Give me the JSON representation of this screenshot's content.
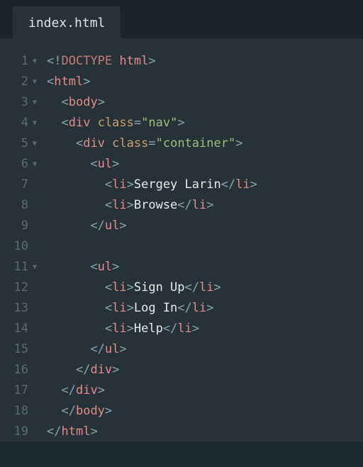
{
  "tab": {
    "filename": "index.html"
  },
  "gutter": {
    "numbers": [
      "1",
      "2",
      "3",
      "4",
      "5",
      "6",
      "7",
      "8",
      "9",
      "10",
      "11",
      "12",
      "13",
      "14",
      "15",
      "16",
      "17",
      "18",
      "19"
    ],
    "folds": [
      true,
      true,
      true,
      true,
      true,
      true,
      false,
      false,
      false,
      false,
      true,
      false,
      false,
      false,
      false,
      false,
      false,
      false,
      false
    ]
  },
  "code": {
    "lines": [
      {
        "indent": 0,
        "kind": "doctype",
        "tag": "html"
      },
      {
        "indent": 0,
        "kind": "open",
        "tag": "html"
      },
      {
        "indent": 1,
        "kind": "open",
        "tag": "body"
      },
      {
        "indent": 1,
        "kind": "open",
        "tag": "div",
        "attr": "class",
        "val": "nav"
      },
      {
        "indent": 2,
        "kind": "open",
        "tag": "div",
        "attr": "class",
        "val": "container"
      },
      {
        "indent": 3,
        "kind": "open",
        "tag": "ul"
      },
      {
        "indent": 4,
        "kind": "li",
        "text": "Sergey Larin"
      },
      {
        "indent": 4,
        "kind": "li",
        "text": "Browse"
      },
      {
        "indent": 3,
        "kind": "close",
        "tag": "ul"
      },
      {
        "indent": 0,
        "kind": "blank"
      },
      {
        "indent": 3,
        "kind": "open",
        "tag": "ul"
      },
      {
        "indent": 4,
        "kind": "li",
        "text": "Sign Up"
      },
      {
        "indent": 4,
        "kind": "li",
        "text": "Log In"
      },
      {
        "indent": 4,
        "kind": "li",
        "text": "Help"
      },
      {
        "indent": 3,
        "kind": "close",
        "tag": "ul"
      },
      {
        "indent": 2,
        "kind": "close",
        "tag": "div"
      },
      {
        "indent": 1,
        "kind": "close",
        "tag": "div"
      },
      {
        "indent": 1,
        "kind": "close",
        "tag": "body"
      },
      {
        "indent": 0,
        "kind": "close",
        "tag": "html"
      }
    ]
  }
}
